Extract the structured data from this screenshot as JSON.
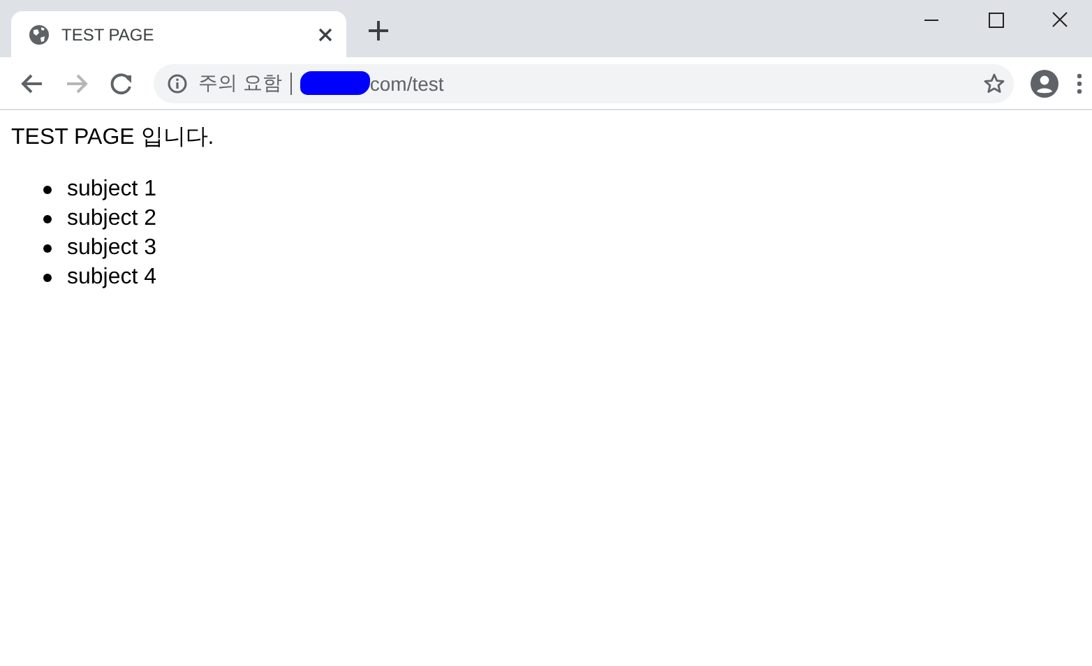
{
  "tab": {
    "title": "TEST PAGE",
    "selected": true
  },
  "address_bar": {
    "security_label": "주의 요함",
    "url": "com/test"
  },
  "page": {
    "heading": "TEST PAGE 입니다.",
    "items": [
      "subject 1",
      "subject 2",
      "subject 3",
      "subject 4"
    ]
  }
}
